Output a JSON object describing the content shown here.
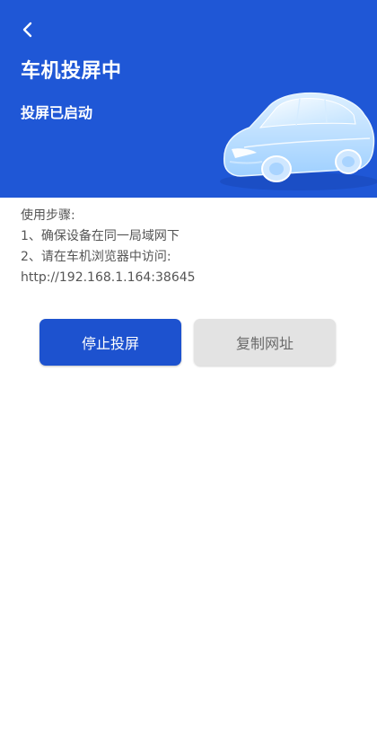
{
  "colors": {
    "header_bg": "#1f57d6",
    "primary_button": "#1d52cf",
    "secondary_button": "#e3e3e3"
  },
  "header": {
    "back_icon": "chevron-left-icon",
    "title": "车机投屏中",
    "status": "投屏已启动",
    "illustration": "car-illustration"
  },
  "instructions": {
    "heading": "使用步骤:",
    "step1": "1、确保设备在同一局域网下",
    "step2": "2、请在车机浏览器中访问:",
    "url": "http://192.168.1.164:38645"
  },
  "actions": {
    "stop_label": "停止投屏",
    "copy_label": "复制网址"
  }
}
